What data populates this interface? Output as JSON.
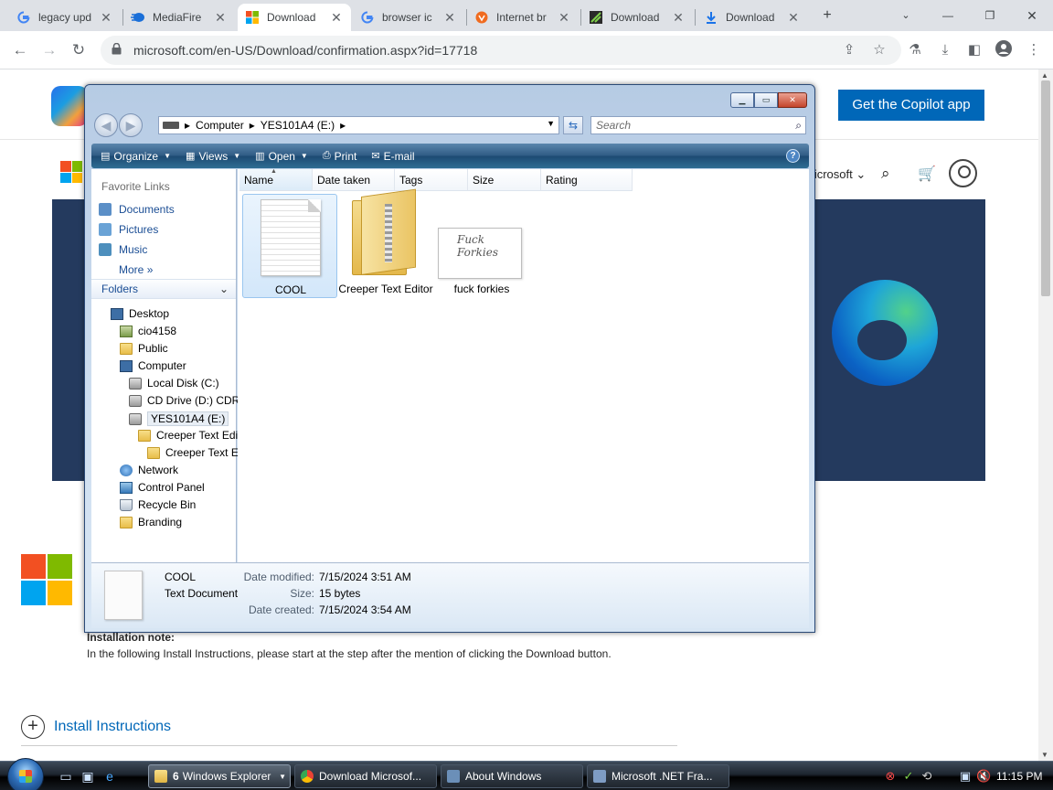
{
  "browser": {
    "tabs": [
      {
        "title": "legacy upd",
        "icon": "google-icon",
        "active": false
      },
      {
        "title": "MediaFire",
        "icon": "mediafire-icon",
        "active": false
      },
      {
        "title": "Download",
        "icon": "microsoft-icon",
        "active": true
      },
      {
        "title": "browser ic",
        "icon": "google-icon",
        "active": false
      },
      {
        "title": "Internet br",
        "icon": "brave-icon",
        "active": false
      },
      {
        "title": "Download",
        "icon": "download-site-icon",
        "active": false
      },
      {
        "title": "Download",
        "icon": "download-arrow-icon",
        "active": false
      }
    ],
    "new_tab": "+",
    "url": "microsoft.com/en-US/Download/confirmation.aspx?id=17718"
  },
  "webpage": {
    "copilot_button": "Get the Copilot app",
    "nav_microsoft": "Microsoft",
    "install_note_title": "Installation note:",
    "install_note_text": "In the following Install Instructions, please start at the step after the mention of clicking the Download button.",
    "install_instructions": "Install Instructions"
  },
  "explorer": {
    "address": {
      "segments": [
        "Computer",
        "YES101A4 (E:)"
      ]
    },
    "search_placeholder": "Search",
    "commands": {
      "organize": "Organize",
      "views": "Views",
      "open": "Open",
      "print": "Print",
      "email": "E-mail"
    },
    "favorite_links_header": "Favorite Links",
    "favorite_links": [
      "Documents",
      "Pictures",
      "Music"
    ],
    "more": "More",
    "folders_header": "Folders",
    "tree": [
      {
        "label": "Desktop",
        "indent": 0,
        "icon": "desktop-icon"
      },
      {
        "label": "cio4158",
        "indent": 1,
        "icon": "user-folder-icon"
      },
      {
        "label": "Public",
        "indent": 1,
        "icon": "folder-icon"
      },
      {
        "label": "Computer",
        "indent": 1,
        "icon": "computer-icon"
      },
      {
        "label": "Local Disk (C:)",
        "indent": 2,
        "icon": "hard-drive-icon"
      },
      {
        "label": "CD Drive (D:) CDR",
        "indent": 2,
        "icon": "cd-drive-icon"
      },
      {
        "label": "YES101A4 (E:)",
        "indent": 2,
        "icon": "usb-drive-icon",
        "selected": true
      },
      {
        "label": "Creeper Text Edi",
        "indent": 3,
        "icon": "folder-icon"
      },
      {
        "label": "Creeper Text E",
        "indent": 4,
        "icon": "folder-icon"
      },
      {
        "label": "Network",
        "indent": 1,
        "icon": "network-icon"
      },
      {
        "label": "Control Panel",
        "indent": 1,
        "icon": "control-panel-icon"
      },
      {
        "label": "Recycle Bin",
        "indent": 1,
        "icon": "recycle-bin-icon"
      },
      {
        "label": "Branding",
        "indent": 1,
        "icon": "folder-icon"
      }
    ],
    "columns": [
      "Name",
      "Date taken",
      "Tags",
      "Size",
      "Rating"
    ],
    "files": [
      {
        "name": "COOL",
        "type": "text-document",
        "selected": true
      },
      {
        "name": "Creeper Text Editor",
        "type": "zip-folder",
        "selected": false
      },
      {
        "name": "fuck forkies",
        "type": "image",
        "selected": false,
        "thumbnail_text": "Fuck Forkies"
      }
    ],
    "details": {
      "name": "COOL",
      "type": "Text Document",
      "date_modified_label": "Date modified:",
      "date_modified": "7/15/2024 3:51 AM",
      "size_label": "Size:",
      "size": "15 bytes",
      "date_created_label": "Date created:",
      "date_created": "7/15/2024 3:54 AM"
    }
  },
  "taskbar": {
    "buttons": [
      {
        "count": "6",
        "label": "Windows Explorer",
        "active": true
      },
      {
        "label": "Download Microsof...",
        "active": false
      },
      {
        "label": "About Windows",
        "active": false
      },
      {
        "label": "Microsoft .NET Fra...",
        "active": false
      }
    ],
    "clock": "11:15 PM"
  }
}
